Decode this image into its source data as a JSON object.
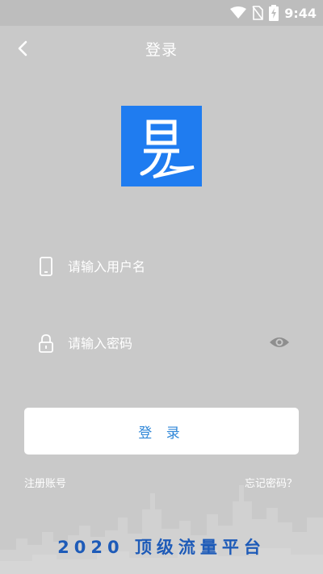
{
  "status_bar": {
    "time": "9:44"
  },
  "header": {
    "title": "登录"
  },
  "form": {
    "username_placeholder": "请输入用户名",
    "password_placeholder": "请输入密码",
    "login_label": "登 录",
    "register_link": "注册账号",
    "forgot_link": "忘记密码？"
  },
  "footer": {
    "slogan": "2020 顶级流量平台"
  },
  "colors": {
    "brand": "#1f7cf0",
    "accent": "#2f87d8",
    "slogan": "#1e5bb8"
  }
}
